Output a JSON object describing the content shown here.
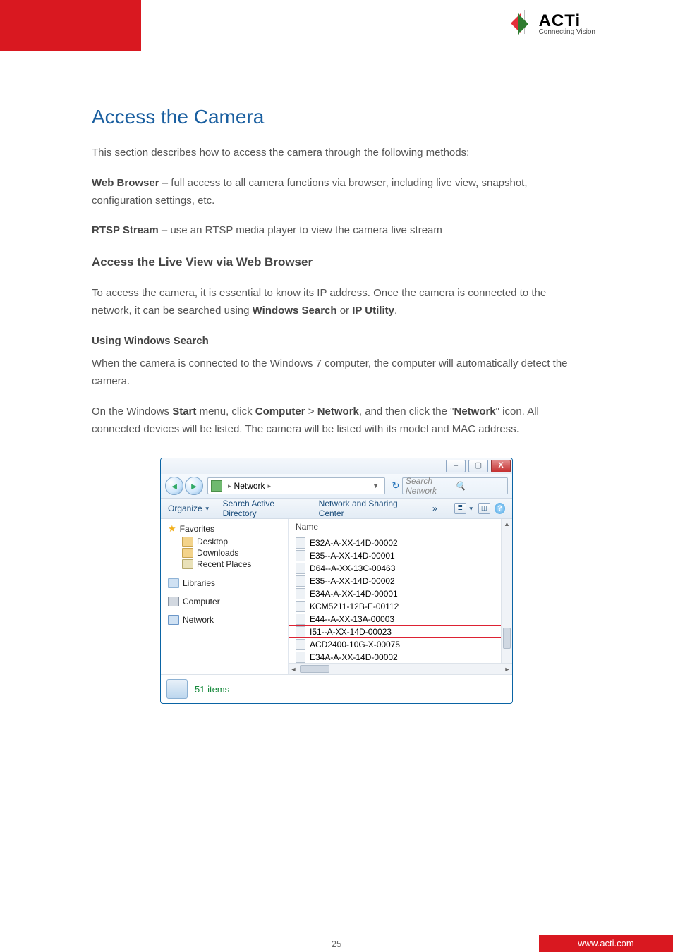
{
  "header": {
    "brand_main": "ACTi",
    "brand_tag": "Connecting Vision"
  },
  "doc": {
    "h1": "Access the Camera",
    "p1": "This section describes how to access the camera through the following methods:",
    "b1_t": "Web Browser",
    "b1_d": " – full access to all camera functions via browser, including live view, snapshot, configuration settings, etc.",
    "b2_t": "RTSP Stream",
    "b2_d": " – use an RTSP media player to view the camera live stream",
    "sub": "Access the Live View via Web Browser",
    "p2a": "To access the camera, it is essential to know its IP address. Once the camera is connected to the network, it can be searched using ",
    "p2b": "Windows Search",
    "p2c": " or ",
    "p2d": "IP Utility",
    "p2e": ".",
    "s1": "Using Windows Search",
    "p3": "When the camera is connected to the Windows 7 computer, the computer will automatically detect the camera.",
    "p4a": "On the Windows ",
    "p4b": "Start",
    "p4c": " menu, click ",
    "p4d": "Computer",
    "p4e": " > ",
    "p4f": "Network",
    "p4g": ", and then click the \"",
    "p4h": "Network",
    "p4i": "\" icon. All connected devices will be listed. The camera will be listed with its model and MAC address."
  },
  "win": {
    "title_min": "–",
    "title_max": "▢",
    "title_close": "X",
    "breadcrumb_root_icon": "net",
    "breadcrumb_root": "Network",
    "breadcrumb_sep": "▸",
    "search_placeholder": "Search Network",
    "toolbar": {
      "organize": "Organize",
      "search_ad": "Search Active Directory",
      "net_center": "Network and Sharing Center",
      "more": "»"
    },
    "sidebar": {
      "favorites": "Favorites",
      "desktop": "Desktop",
      "downloads": "Downloads",
      "recent": "Recent Places",
      "libraries": "Libraries",
      "computer": "Computer",
      "network": "Network"
    },
    "col_name": "Name",
    "items": [
      "E32A-A-XX-14D-00002",
      "E35--A-XX-14D-00001",
      "D64--A-XX-13C-00463",
      "E35--A-XX-14D-00002",
      "E34A-A-XX-14D-00001",
      "KCM5211-12B-E-00112",
      "E44--A-XX-13A-00003",
      "I51--A-XX-14D-00023",
      "ACD2400-10G-X-00075",
      "E34A-A-XX-14D-00002"
    ],
    "selected_index": 7,
    "status_count": "51 items"
  },
  "footer": {
    "page": "25",
    "url": "www.acti.com"
  }
}
